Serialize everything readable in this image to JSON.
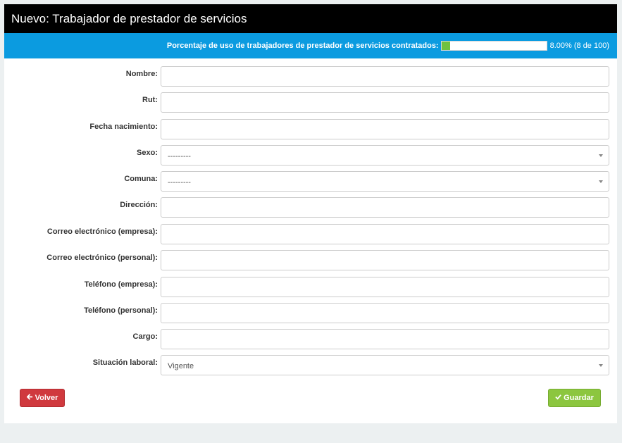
{
  "header": {
    "title": "Nuevo: Trabajador de prestador de servicios"
  },
  "usage": {
    "label": "Porcentaje de uso de trabajadores de prestador de servicios contratados:",
    "percent_fraction": 0.08,
    "value_text": "8.00% (8 de 100)",
    "bar_color": "#6fc23f",
    "bg_color": "#0b9be0"
  },
  "form": {
    "fields": [
      {
        "label": "Nombre:",
        "type": "text",
        "value": ""
      },
      {
        "label": "Rut:",
        "type": "text",
        "value": ""
      },
      {
        "label": "Fecha nacimiento:",
        "type": "text",
        "value": ""
      },
      {
        "label": "Sexo:",
        "type": "select",
        "value": "---------"
      },
      {
        "label": "Comuna:",
        "type": "select",
        "value": "---------"
      },
      {
        "label": "Dirección:",
        "type": "text",
        "value": ""
      },
      {
        "label": "Correo electrónico (empresa):",
        "type": "text",
        "value": ""
      },
      {
        "label": "Correo electrónico (personal):",
        "type": "text",
        "value": ""
      },
      {
        "label": "Teléfono (empresa):",
        "type": "text",
        "value": ""
      },
      {
        "label": "Teléfono (personal):",
        "type": "text",
        "value": ""
      },
      {
        "label": "Cargo:",
        "type": "text",
        "value": ""
      },
      {
        "label": "Situación laboral:",
        "type": "select",
        "value": "Vigente"
      }
    ]
  },
  "actions": {
    "back_label": "Volver",
    "back_icon": "arrow-left-icon",
    "back_color": "#d0393e",
    "save_label": "Guardar",
    "save_icon": "check-icon",
    "save_color": "#8cc63f"
  }
}
